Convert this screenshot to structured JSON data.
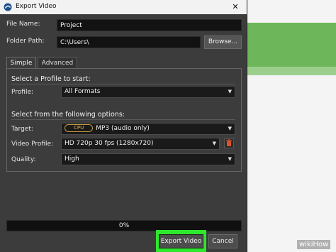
{
  "window": {
    "title": "Export Video",
    "close_glyph": "✕"
  },
  "fields": {
    "file_name_label": "File Name:",
    "file_name_value": "Project",
    "folder_path_label": "Folder Path:",
    "folder_path_value": "C:\\Users\\",
    "browse_label": "Browse..."
  },
  "tabs": [
    {
      "label": "Simple",
      "active": true
    },
    {
      "label": "Advanced",
      "active": false
    }
  ],
  "profile_section": {
    "title": "Select a Profile to start:",
    "profile_label": "Profile:",
    "profile_value": "All Formats"
  },
  "options_section": {
    "title": "Select from the following options:",
    "target_label": "Target:",
    "target_badge": "CPU",
    "target_value": "MP3 (audio only)",
    "video_profile_label": "Video Profile:",
    "video_profile_value": "HD 720p 30 fps (1280x720)",
    "quality_label": "Quality:",
    "quality_value": "High"
  },
  "progress": {
    "text": "0%",
    "value": 0
  },
  "actions": {
    "export_label": "Export Video",
    "cancel_label": "Cancel"
  },
  "icons": {
    "app": "openshot-icon",
    "dropdown": "chevron-down-icon",
    "delete": "trash-icon",
    "close": "close-icon"
  },
  "colors": {
    "highlight": "#2ee82e",
    "accent_badge": "#c89a3a",
    "dialog_bg": "#3c3c3c"
  },
  "watermark": {
    "text": "wikiHow"
  }
}
